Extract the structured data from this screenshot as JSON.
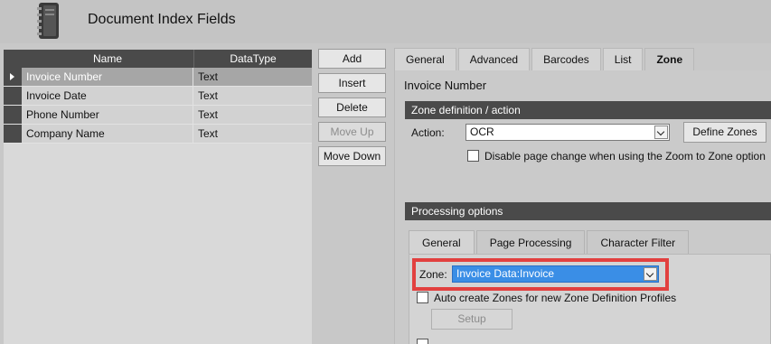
{
  "window": {
    "title": "Document Index Fields",
    "icon": "notebook-icon"
  },
  "grid": {
    "columns": [
      "Name",
      "DataType"
    ],
    "rows": [
      {
        "name": "Invoice Number",
        "type": "Text",
        "selected": true
      },
      {
        "name": "Invoice Date",
        "type": "Text"
      },
      {
        "name": "Phone Number",
        "type": "Text"
      },
      {
        "name": "Company Name",
        "type": "Text"
      }
    ]
  },
  "side_buttons": {
    "add": "Add",
    "insert": "Insert",
    "delete": "Delete",
    "move_up": "Move Up",
    "move_down": "Move Down"
  },
  "tabs": {
    "general": "General",
    "advanced": "Advanced",
    "barcodes": "Barcodes",
    "list": "List",
    "zone": "Zone"
  },
  "zone_tab": {
    "field_name": "Invoice Number",
    "section_zone_def": "Zone definition / action",
    "action_label": "Action:",
    "action_value": "OCR",
    "define_zones": "Define Zones",
    "disable_page_change": "Disable page change when using the Zoom to Zone option",
    "section_processing": "Processing options",
    "subtabs": {
      "general": "General",
      "page_processing": "Page Processing",
      "character_filter": "Character Filter"
    },
    "zone_label": "Zone:",
    "zone_value": "Invoice Data:Invoice",
    "auto_create": "Auto create Zones for new Zone Definition Profiles",
    "setup": "Setup"
  },
  "colors": {
    "highlight": "#e2403f",
    "selection": "#3a8ee6",
    "header_dark": "#4a4a4a"
  }
}
